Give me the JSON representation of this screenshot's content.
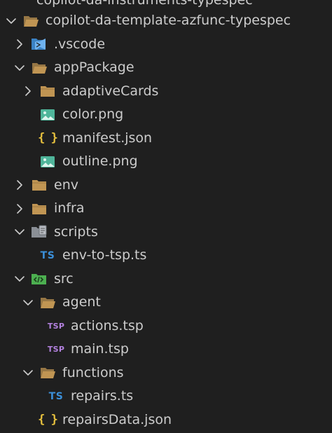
{
  "explorer": {
    "top_partial": {
      "label": "copilot-da-instruments-typespec"
    },
    "items": [
      {
        "label": "copilot-da-template-azfunc-typespec",
        "depth": 0,
        "chevron": "down",
        "icon": "folder-open-icon"
      },
      {
        "label": ".vscode",
        "depth": 1,
        "chevron": "right",
        "icon": "vscode-folder-icon"
      },
      {
        "label": "appPackage",
        "depth": 1,
        "chevron": "down",
        "icon": "folder-open-icon"
      },
      {
        "label": "adaptiveCards",
        "depth": 2,
        "chevron": "right",
        "icon": "folder-icon"
      },
      {
        "label": "color.png",
        "depth": 2,
        "chevron": "none",
        "icon": "image-icon"
      },
      {
        "label": "manifest.json",
        "depth": 2,
        "chevron": "none",
        "icon": "json-icon"
      },
      {
        "label": "outline.png",
        "depth": 2,
        "chevron": "none",
        "icon": "image-icon"
      },
      {
        "label": "env",
        "depth": 1,
        "chevron": "right",
        "icon": "folder-icon"
      },
      {
        "label": "infra",
        "depth": 1,
        "chevron": "right",
        "icon": "folder-icon"
      },
      {
        "label": "scripts",
        "depth": 1,
        "chevron": "down",
        "icon": "scripts-folder-icon"
      },
      {
        "label": "env-to-tsp.ts",
        "depth": 2,
        "chevron": "none",
        "icon": "typescript-icon"
      },
      {
        "label": "src",
        "depth": 1,
        "chevron": "down",
        "icon": "src-folder-icon"
      },
      {
        "label": "agent",
        "depth": 2,
        "chevron": "down",
        "icon": "folder-open-icon"
      },
      {
        "label": "actions.tsp",
        "depth": 3,
        "chevron": "none",
        "icon": "typespec-icon"
      },
      {
        "label": "main.tsp",
        "depth": 3,
        "chevron": "none",
        "icon": "typespec-icon"
      },
      {
        "label": "functions",
        "depth": 2,
        "chevron": "down",
        "icon": "folder-open-icon"
      },
      {
        "label": "repairs.ts",
        "depth": 3,
        "chevron": "none",
        "icon": "typescript-icon"
      },
      {
        "label": "repairsData.json",
        "depth": 2,
        "chevron": "none",
        "icon": "json-icon"
      }
    ]
  },
  "badges": {
    "ts": "TS",
    "tsp": "TSP",
    "json": "{ }"
  },
  "colors": {
    "background": "#1f1f1f",
    "text": "#cccccc",
    "folder": "#c09553",
    "vscode": "#3b82c4",
    "image": "#4fb59a",
    "json": "#e8c23e",
    "typescript": "#3b8fd8",
    "typespec": "#b482e0",
    "src": "#4caf50"
  }
}
